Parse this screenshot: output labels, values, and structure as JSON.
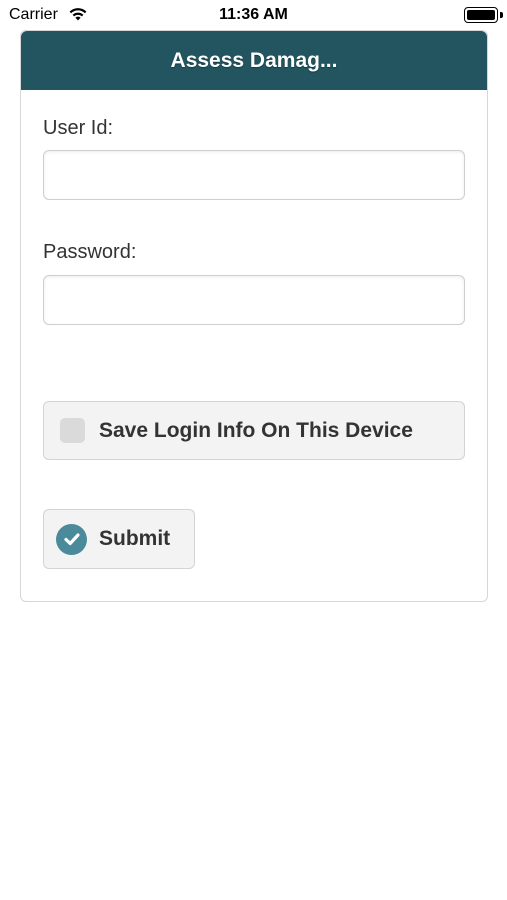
{
  "status_bar": {
    "carrier": "Carrier",
    "time": "11:36 AM",
    "wifi_icon": "wifi-icon",
    "battery_icon": "battery-icon"
  },
  "header": {
    "title": "Assess Damag...",
    "color": "#225560"
  },
  "form": {
    "user_id_label": "User Id:",
    "user_id_value": "",
    "password_label": "Password:",
    "password_value": "",
    "save_login_label": "Save Login Info On This Device",
    "save_login_checked": false,
    "submit_label": "Submit",
    "submit_icon": "check-circle-icon",
    "accent": "#4a8a9a"
  }
}
